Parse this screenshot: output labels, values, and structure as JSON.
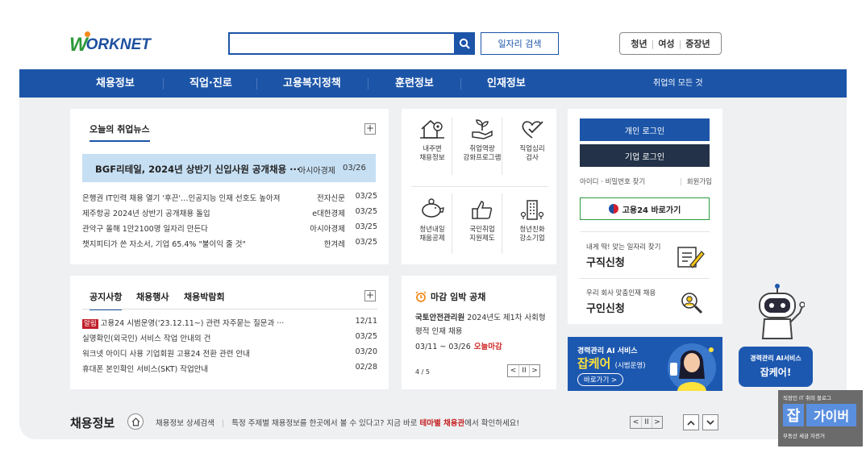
{
  "header": {
    "logo": {
      "first": "W",
      "rest": "ORKNET"
    },
    "search": {
      "placeholder": "",
      "button_label": "일자리 검색"
    },
    "targets": [
      "청년",
      "여성",
      "중장년"
    ]
  },
  "nav": {
    "items": [
      "채용정보",
      "직업·진로",
      "고용복지정책",
      "훈련정보",
      "인재정보"
    ],
    "all_menu": "취업의 모든 것"
  },
  "news": {
    "title": "오늘의 취업뉴스",
    "plus": "+",
    "headline": {
      "title": "BGF리테일, 2024년 상반기 신입사원 공개채용 ···",
      "source": "아시아경제",
      "date": "03/26"
    },
    "items": [
      {
        "title": "은행권 IT인력 채용 열기 '후끈'…인공지능 인재 선호도 높아져",
        "source": "전자신문",
        "date": "03/25"
      },
      {
        "title": "제주항공 2024년 상반기 공개채용 돌입",
        "source": "e대한경제",
        "date": "03/25"
      },
      {
        "title": "관악구 올해 1만2100명 일자리 만든다",
        "source": "아시아경제",
        "date": "03/25"
      },
      {
        "title": "챗지피티가 쓴 자소서, 기업 65.4% \"불이익 줄 것\"",
        "source": "한겨레",
        "date": "03/25"
      }
    ]
  },
  "services": [
    {
      "label": "내주변\n채용정보",
      "icon": "house-pin-icon"
    },
    {
      "label": "취업역량\n강화프로그램",
      "icon": "sprout-hand-icon"
    },
    {
      "label": "직업심리\n검사",
      "icon": "heart-check-icon"
    },
    {
      "label": "청년내일\n채움공제",
      "icon": "piggy-bank-icon"
    },
    {
      "label": "국민취업\n지원제도",
      "icon": "thumbs-up-icon"
    },
    {
      "label": "청년친화\n강소기업",
      "icon": "building-icon"
    }
  ],
  "login": {
    "personal": "개인 로그인",
    "corporate": "기업 로그인",
    "find": "아이디 · 비밀번호 찾기",
    "join": "회원가입",
    "gov24": "고용24 바로가기"
  },
  "job_request": {
    "small": "내게 딱! 맞는 일자리 찾기",
    "big": "구직신청"
  },
  "hire_request": {
    "small": "우리 회사 맞춤인재 채용",
    "big": "구인신청"
  },
  "notice": {
    "tabs": [
      "공지사항",
      "채용행사",
      "채용박람회"
    ],
    "plus": "+",
    "items": [
      {
        "tag": "알림",
        "title": "고용24 시범운영('23.12.11~) 관련 자주묻는 질문과 ···",
        "date": "12/11"
      },
      {
        "tag": "",
        "title": "실명확인(외국인) 서비스 작업 안내의 건",
        "date": "03/25"
      },
      {
        "tag": "",
        "title": "워크넷 아이디 사용 기업회원 고용24 전환 관련 안내",
        "date": "03/20"
      },
      {
        "tag": "",
        "title": "휴대폰 본인확인 서비스(SKT) 작업안내",
        "date": "02/28"
      }
    ]
  },
  "deadline": {
    "title": "마감 임박 공채",
    "org": "국토안전관리원",
    "desc": "2024년도 제1차 사회형평적 인재 채용",
    "period": "03/11 ~ 03/26",
    "status": "오늘마감",
    "page": "4 / 5",
    "pager": [
      "<",
      "II",
      ">"
    ]
  },
  "ai_banner": {
    "line1": "경력관리 AI 서비스",
    "line2": "잡케어",
    "line2_small": "(시범운영)",
    "cta": "바로가기 >"
  },
  "floating_ai": {
    "line1": "경력관리 AI서비스",
    "line2": "잡케어!"
  },
  "bottom": {
    "title": "채용정보",
    "link": "채용정보 상세검색",
    "text_before": "특정 주제별 채용정보를 한곳에서 볼 수 있다고? 지금 바로 ",
    "text_highlight": "테마별 채용관",
    "text_after": "에서 확인하세요!",
    "pager": [
      "<",
      "II",
      ">"
    ]
  },
  "badge": {
    "top": "직장인 IT 취미 블로그",
    "j": "잡",
    "g": "가이버",
    "bottom": "부동산 세금 자전거"
  },
  "colors": {
    "primary": "#1c55a8",
    "green": "#2e9a3a",
    "orange": "#f08a1c",
    "red": "#c0202a",
    "headline_bg": "#c6dff3"
  }
}
